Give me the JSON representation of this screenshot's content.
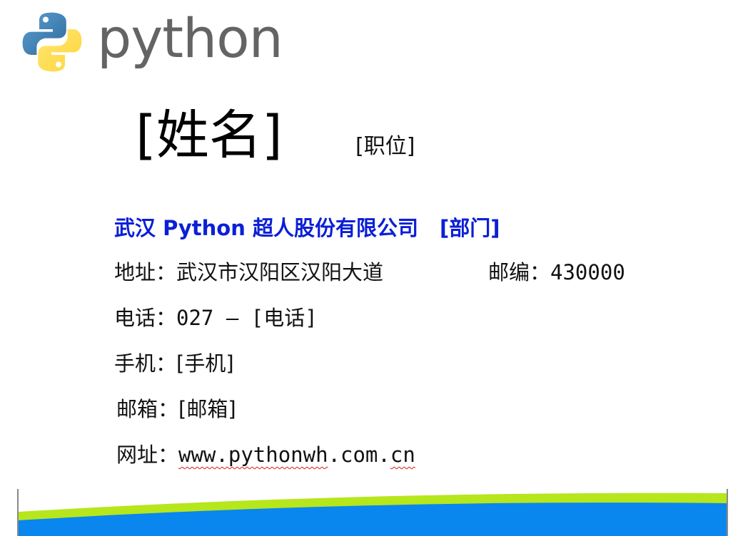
{
  "logo": {
    "icon": "python-logo-icon",
    "wordmark": "python"
  },
  "card": {
    "name": "[姓名]",
    "position": "[职位]",
    "company": "武汉 Python 超人股份有限公司",
    "department": "[部门]",
    "address_label": "地址：",
    "address_value": "武汉市汉阳区汉阳大道",
    "postal_label": "邮编：",
    "postal_value": "430000",
    "phone_label": "电话：",
    "phone_value": "027 – [电话]",
    "mobile_label": "手机：",
    "mobile_value": "[手机]",
    "email_label": "邮箱：",
    "email_value": "[邮箱]",
    "website_label": "网址：",
    "website_part1": "www.",
    "website_part2": "pythonwh",
    "website_part3": ".com.",
    "website_part4": "cn"
  },
  "colors": {
    "company_text": "#0b1fd6",
    "banner_blue": "#0a86ef",
    "banner_green": "#b6e61c",
    "logo_blue": "#3e7ab3",
    "logo_yellow": "#ffd43b",
    "wordmark_gray": "#646464"
  }
}
